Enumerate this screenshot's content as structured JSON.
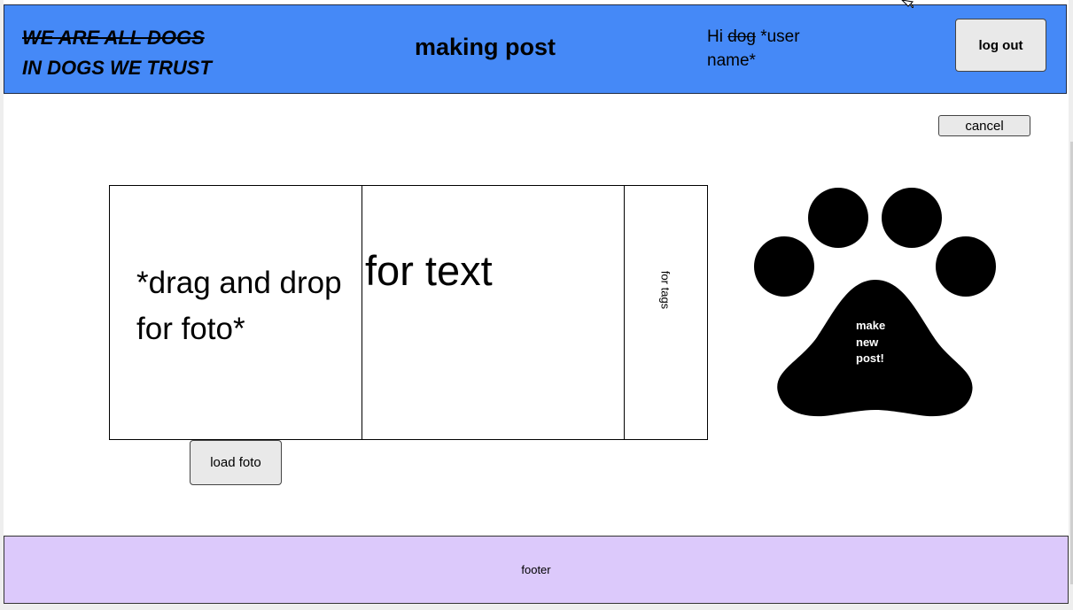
{
  "header": {
    "slogan_line1": "WE ARE ALL DOGS",
    "slogan_line2": "IN DOGS WE TRUST",
    "title": "making post",
    "greeting_prefix": "Hi ",
    "greeting_struck": "dog",
    "greeting_user": " *user name*",
    "logout_label": "log out",
    "background_color": "#4589f7"
  },
  "actions": {
    "cancel_label": "cancel",
    "load_photo_label": "load foto",
    "make_post_label": "make\nnew\npost!",
    "make_post_icon": "paw-icon"
  },
  "editor": {
    "photo_placeholder_line1": "*drag and drop",
    "photo_placeholder_line2": "for foto*",
    "text_placeholder": "for text",
    "tags_placeholder": "for tags"
  },
  "footer": {
    "label": "footer",
    "background_color": "#dcc9fb"
  }
}
